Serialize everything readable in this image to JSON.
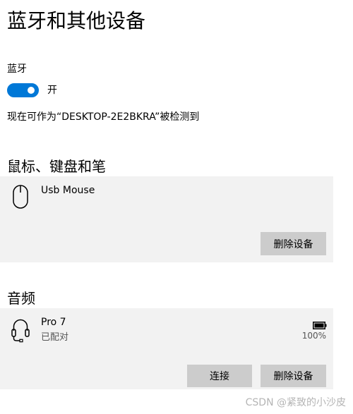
{
  "page": {
    "title": "蓝牙和其他设备"
  },
  "bluetooth": {
    "label": "蓝牙",
    "toggle_on": true,
    "toggle_text": "开",
    "discoverable_text": "现在可作为“DESKTOP-2E2BKRA”被检测到"
  },
  "mouse_section": {
    "heading": "鼠标、键盘和笔",
    "device": {
      "name": "Usb Mouse",
      "icon": "mouse-icon",
      "remove_label": "删除设备"
    }
  },
  "audio_section": {
    "heading": "音频",
    "device": {
      "name": "Pro 7",
      "status": "已配对",
      "icon": "headset-icon",
      "battery_icon": "battery-icon",
      "battery_text": "100%",
      "battery_level": 1.0,
      "connect_label": "连接",
      "remove_label": "删除设备"
    }
  },
  "watermark": "CSDN @紧致的小沙皮",
  "colors": {
    "accent": "#0078d7",
    "card_background": "#f2f2f2",
    "button_background": "#cccccc",
    "secondary_text": "#555555"
  }
}
